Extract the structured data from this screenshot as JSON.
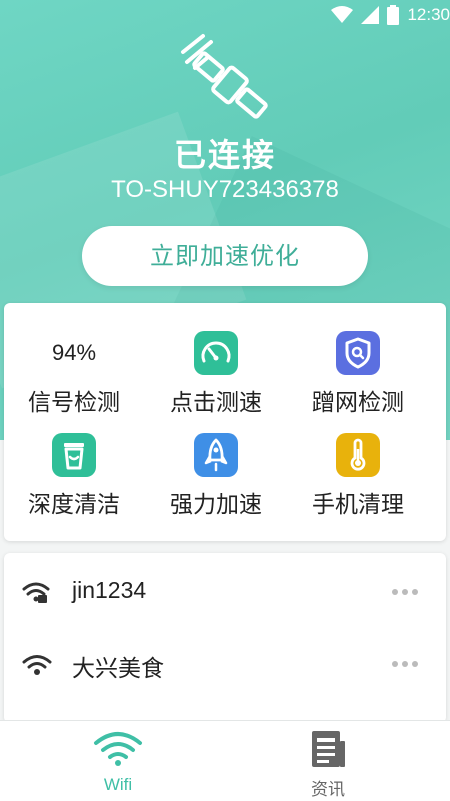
{
  "status_bar": {
    "time": "12:30"
  },
  "header": {
    "status": "已连接",
    "ssid": "TO-SHUY723436378",
    "boost_button": "立即加速优化"
  },
  "tools": [
    {
      "value": "94%",
      "label": "信号检测"
    },
    {
      "icon": "speedometer-icon",
      "color": "#2fbf98",
      "label": "点击测速"
    },
    {
      "icon": "shield-icon",
      "color": "#5b6fe0",
      "label": "蹭网检测"
    },
    {
      "icon": "trash-can-icon",
      "color": "#2fbf98",
      "label": "深度清洁"
    },
    {
      "icon": "rocket-icon",
      "color": "#3f8fe6",
      "label": "强力加速"
    },
    {
      "icon": "thermometer-icon",
      "color": "#e8b20c",
      "label": "手机清理"
    }
  ],
  "wifi_list": [
    {
      "name": "jin1234",
      "icon": "wifi-locked-icon"
    },
    {
      "name": "大兴美食",
      "icon": "wifi-icon"
    }
  ],
  "tabs": [
    {
      "label": "Wifi",
      "active": true,
      "icon": "wifi-icon",
      "color": "#3fbfa6"
    },
    {
      "label": "资讯",
      "active": false,
      "icon": "news-icon",
      "color": "#666666"
    }
  ]
}
